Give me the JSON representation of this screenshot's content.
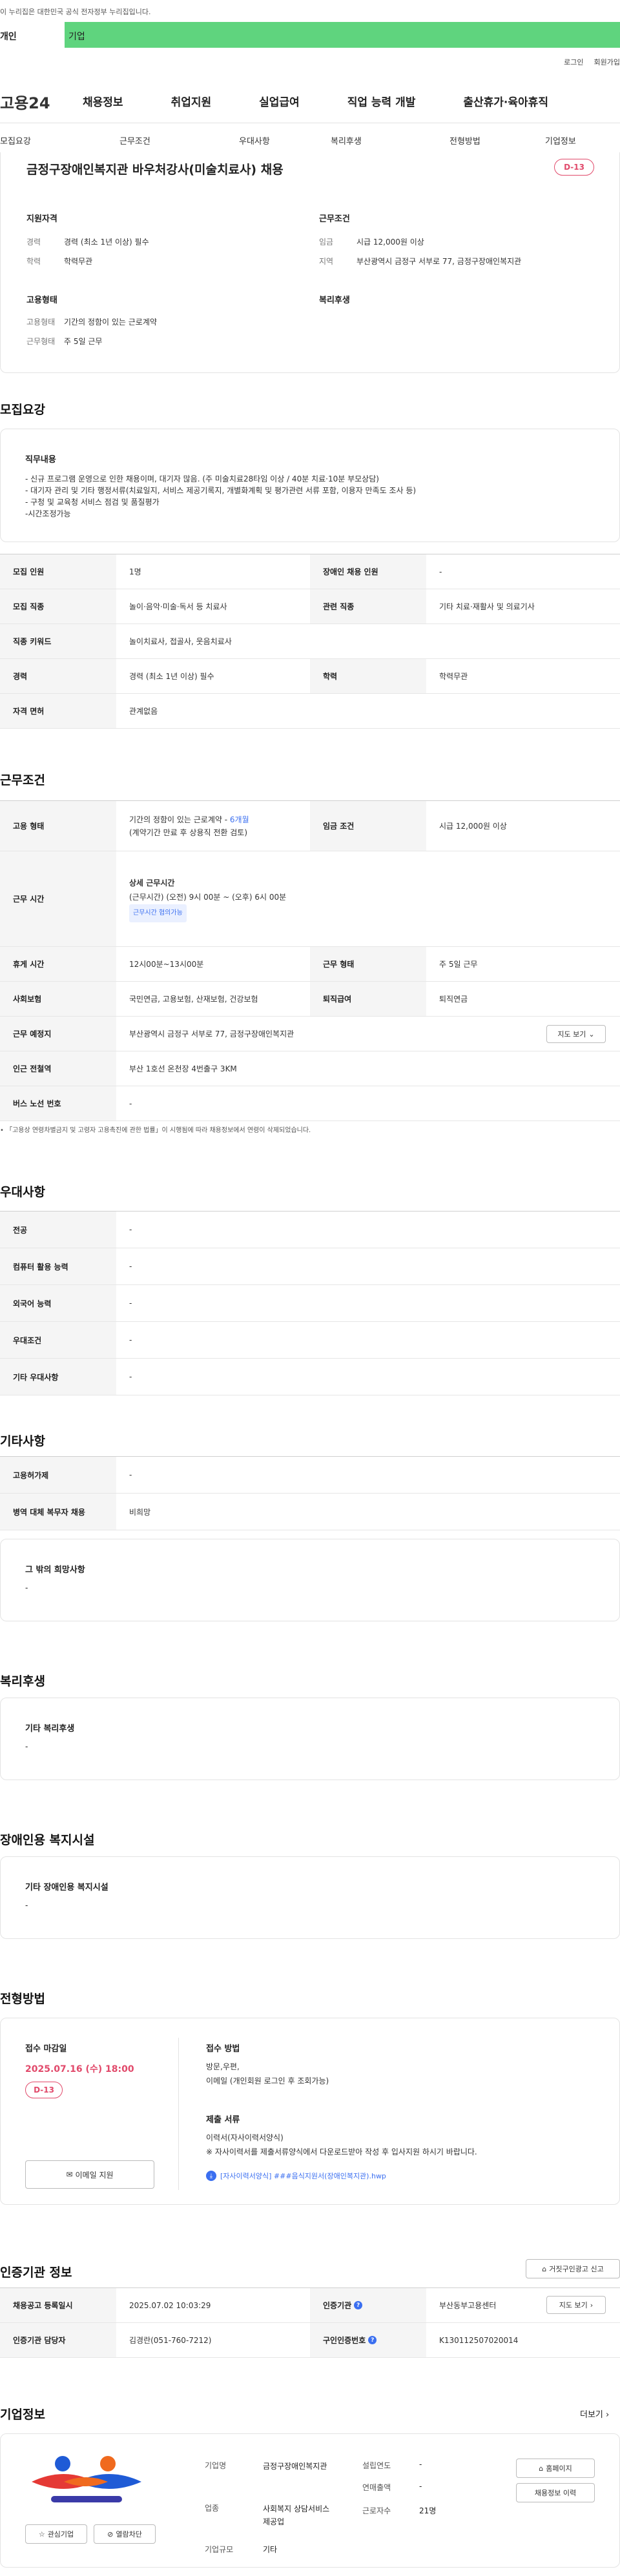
{
  "gov_notice": "이 누리집은 대한민국 공식 전자정부 누리집입니다.",
  "audience_tabs": [
    "개인",
    "기업"
  ],
  "util_links": [
    "로그인",
    "회원가입"
  ],
  "logo": "고용24",
  "gnb": [
    "채용정보",
    "취업지원",
    "실업급여",
    "직업 능력 개발",
    "출산휴가·육아휴직"
  ],
  "subnav": [
    "모집요강",
    "근무조건",
    "우대사항",
    "복리후생",
    "전형방법",
    "기업정보"
  ],
  "job": {
    "title": "금정구장애인복지관 바우처강사(미술치료사) 채용",
    "dday": "D-13",
    "summary_left_title": "지원자격",
    "career_k": "경력",
    "career_v": "경력 (최소 1년 이상) 필수",
    "edu_k": "학력",
    "edu_v": "학력무관",
    "summary_right_title": "근무조건",
    "wage_k": "임금",
    "wage_v": "시급 12,000원 이상",
    "region_k": "지역",
    "region_v": "부산광역시 금정구 서부로 77, 금정구장애인복지관",
    "emp_title": "고용형태",
    "emptype_k": "고용형태",
    "emptype_v": "기간의 정함이 있는 근로계약",
    "worktype_k": "근무형태",
    "worktype_v": "주 5일 근무",
    "welfare_title": "복리후생"
  },
  "recruit": {
    "heading": "모집요강",
    "duty_title": "직무내용",
    "duty_lines": [
      "- 신규 프로그램 운영으로 인한 채용이며, 대기자 많음. (주 미술치료28타임 이상 / 40분 치료·10분 부모상담)",
      "- 대기자 관리 및 기타 행정서류(치료일지, 서비스 제공기록지, 개별화계획 및 평가관련 서류 포함, 이용자 만족도 조사 등)",
      "- 구청 및 교육청 서비스 점검 및 품질평가",
      "-시간조정가능"
    ],
    "rows": [
      [
        "모집 인원",
        "1명",
        "장애인 채용 인원",
        "-"
      ],
      [
        "모집 직종",
        "놀이·음악·미술·독서 등 치료사",
        "관련 직종",
        "기타 치료·재활사 및 의료기사"
      ],
      [
        "직종 키워드",
        "놀이치료사, 접골사, 웃음치료사",
        "",
        ""
      ],
      [
        "경력",
        "경력 (최소 1년 이상) 필수",
        "학력",
        "학력무관"
      ],
      [
        "자격 면허",
        "관계없음",
        "",
        ""
      ]
    ]
  },
  "conditions": {
    "heading": "근무조건",
    "emp_th": "고용 형태",
    "emp_line1": "기간의 정함이 있는 근로계약 - ",
    "emp_months": "6개월",
    "emp_line2": "(계약기간 만료 후 상용직 전환 검토)",
    "wage_th": "임금 조건",
    "wage_td": "시급 12,000원 이상",
    "hours_th": "근무 시간",
    "hours_title": "상세 근무시간",
    "hours_line": "(근무시간) (오전) 9시 00분 ~ (오후) 6시 00분",
    "hours_chip": "근무시간 협의가능",
    "rows": [
      [
        "휴게 시간",
        "12시00분~13시00분",
        "근무 형태",
        "주 5일 근무"
      ],
      [
        "사회보험",
        "국민연금, 고용보험, 산재보험, 건강보험",
        "퇴직급여",
        "퇴직연금"
      ]
    ],
    "place_th": "근무 예정지",
    "place_td": "부산광역시 금정구 서부로 77, 금정구장애인복지관",
    "map_btn": "지도 보기",
    "subway_th": "인근 전철역",
    "subway_td": "부산 1호선 온천장 4번출구 3KM",
    "bus_th": "버스 노선 번호",
    "bus_td": "-",
    "footnote": "「고용상 연령차별금지 및 고령자 고용촉진에 관한 법률」이 시행됨에 따라 채용정보에서 연령이 삭제되었습니다."
  },
  "preference": {
    "heading": "우대사항",
    "rows": [
      [
        "전공",
        "-"
      ],
      [
        "컴퓨터 활용 능력",
        "-"
      ],
      [
        "외국어 능력",
        "-"
      ],
      [
        "우대조건",
        "-"
      ],
      [
        "기타 우대사항",
        "-"
      ]
    ]
  },
  "other": {
    "heading": "기타사항",
    "rows": [
      [
        "고용허가제",
        "-"
      ],
      [
        "병역 대체 복무자 채용",
        "비희망"
      ]
    ],
    "wish_title": "그 밖의 희망사항",
    "wish_value": "-"
  },
  "welfare": {
    "heading": "복리후생",
    "title": "기타 복리후생",
    "value": "-"
  },
  "facility": {
    "heading": "장애인용 복지시설",
    "title": "기타 장애인용 복지시설",
    "value": "-"
  },
  "selection": {
    "heading": "전형방법",
    "deadline_title": "접수 마감일",
    "deadline_date": "2025.07.16 (수) 18:00",
    "dday": "D-13",
    "email_btn": "이메일 지원",
    "method_title": "접수 방법",
    "method_lines": [
      "방문,우편,",
      "이메일 (개인회원 로그인 후 조회가능)"
    ],
    "docs_title": "제출 서류",
    "docs_lines": [
      "이력서(자사이력서양식)",
      "※ 자사이력서를 제출서류양식에서 다운로드받아 작성 후 입사지원 하시기 바랍니다."
    ],
    "file_link": "[자사이력서양식] ###음식지원서(장애인복지관).hwp"
  },
  "agency": {
    "heading": "인증기관 정보",
    "report_btn": "거짓구인광고 신고",
    "rows": [
      [
        "채용공고 등록일시",
        "2025.07.02 10:03:29",
        "인증기관",
        "부산동부고용센터"
      ],
      [
        "인증기관 담당자",
        "김경란(051-760-7212)",
        "구인인증번호",
        "K130112507020014"
      ]
    ],
    "map_btn": "지도 보기"
  },
  "company": {
    "heading": "기업정보",
    "more": "더보기",
    "interest_btn": "관심기업",
    "block_btn": "열람차단",
    "name_k": "기업명",
    "name_v": "금정구장애인복지관",
    "industry_k": "업종",
    "industry_v": "사회복지 상담서비스 제공업",
    "size_k": "기업규모",
    "size_v": "기타",
    "founded_k": "설립연도",
    "founded_v": "-",
    "sales_k": "연매출액",
    "sales_v": "-",
    "staff_k": "근로자수",
    "staff_v": "21명",
    "homepage_btn": "홈페이지",
    "jobs_btn": "채용정보 이력"
  },
  "colors": {
    "accent_green": "#5fd47e",
    "dday_pink": "#e14a6b",
    "link_blue": "#3b6ff0"
  }
}
